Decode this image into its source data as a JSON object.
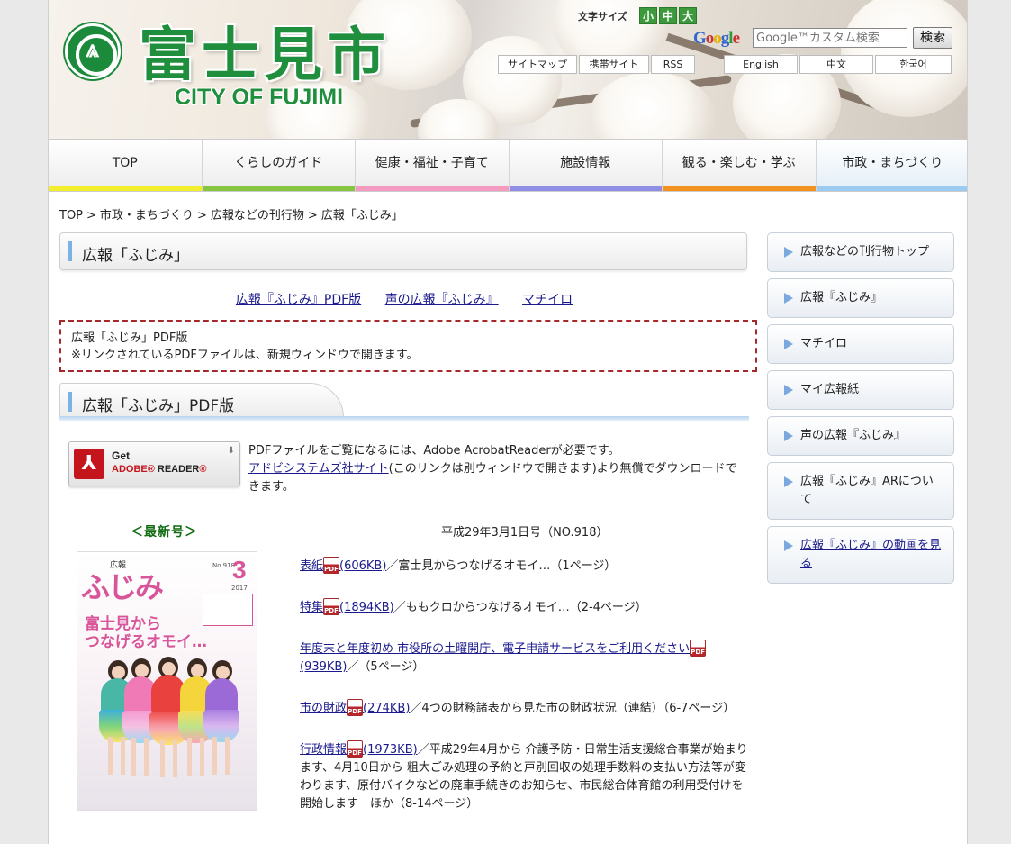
{
  "header": {
    "logo_text": "富士見市",
    "logo_en": "CITY OF FUJIMI",
    "font_size_label": "文字サイズ",
    "font_sizes": [
      "小",
      "中",
      "大"
    ],
    "google_logo": "Google",
    "search_placeholder": "Google™カスタム検索",
    "search_button": "検索",
    "util_links": [
      "サイトマップ",
      "携帯サイト",
      "RSS"
    ],
    "languages": [
      "English",
      "中文",
      "한국어"
    ]
  },
  "colors": {
    "nav_bars": [
      "#f2ee2c",
      "#87c540",
      "#f59ac0",
      "#8f8fe6",
      "#f3921f",
      "#9ccaf0"
    ],
    "brand_green": "#1f8f3d",
    "notice_border": "#a5282b"
  },
  "nav": {
    "items": [
      "TOP",
      "くらしのガイド",
      "健康・福祉・子育て",
      "施設情報",
      "観る・楽しむ・学ぶ",
      "市政・まちづくり"
    ],
    "active_index": 5
  },
  "breadcrumb": {
    "items": [
      "TOP",
      "市政・まちづくり",
      "広報などの刊行物",
      "広報「ふじみ」"
    ],
    "separator": ">"
  },
  "main": {
    "title": "広報「ふじみ」",
    "subnav": [
      "広報『ふじみ』PDF版",
      "声の広報『ふじみ』",
      "マチイロ"
    ],
    "notice_line1": "広報「ふじみ」PDF版",
    "notice_line2": "※リンクされているPDFファイルは、新規ウィンドウで開きます。",
    "section_title": "広報「ふじみ」PDF版",
    "acrobat": {
      "get": "Get",
      "adobe": "ADOBE",
      "reader": "READER",
      "text1": "PDFファイルをご覧になるには、Adobe AcrobatReaderが必要です。",
      "link": "アドビシステムズ社サイト",
      "text2": "(このリンクは別ウィンドウで開きます)より無償でダウンロードできます。"
    },
    "latest_label": "＜最新号＞",
    "issue_date": "平成29年3月1日号（NO.918）",
    "cover": {
      "tag": "広報",
      "logo": "ふじみ",
      "no": "No.918",
      "month": "3",
      "year": "2017",
      "headline_1": "富士見から",
      "headline_2": "つなげるオモイ…"
    },
    "pdf_icon_label": "PDF",
    "articles": [
      {
        "title": "表紙",
        "size": "(606KB)",
        "desc": "／富士見からつなげるオモイ…（1ページ）"
      },
      {
        "title": "特集",
        "size": "(1894KB)",
        "desc": "／ももクロからつなげるオモイ…（2-4ページ）"
      },
      {
        "title": "年度末と年度初め 市役所の土曜開庁、電子申請サービスをご利用ください",
        "size": "(939KB)",
        "desc": "／（5ページ）"
      },
      {
        "title": "市の財政",
        "size": "(274KB)",
        "desc": "／4つの財務諸表から見た市の財政状況（連結）（6-7ページ）"
      },
      {
        "title": "行政情報",
        "size": "(1973KB)",
        "desc": "／平成29年4月から 介護予防・日常生活支援総合事業が始まります、4月10日から 粗大ごみ処理の予約と戸別回収の処理手数料の支払い方法等が変わります、原付バイクなどの廃車手続きのお知らせ、市民総合体育館の利用受付けを開始します　ほか（8-14ページ）"
      }
    ]
  },
  "sidebar": {
    "items": [
      "広報などの刊行物トップ",
      "広報『ふじみ』",
      "マチイロ",
      "マイ広報紙",
      "声の広報『ふじみ』",
      "広報『ふじみ』ARについて",
      "広報『ふじみ』の動画を見る"
    ]
  }
}
